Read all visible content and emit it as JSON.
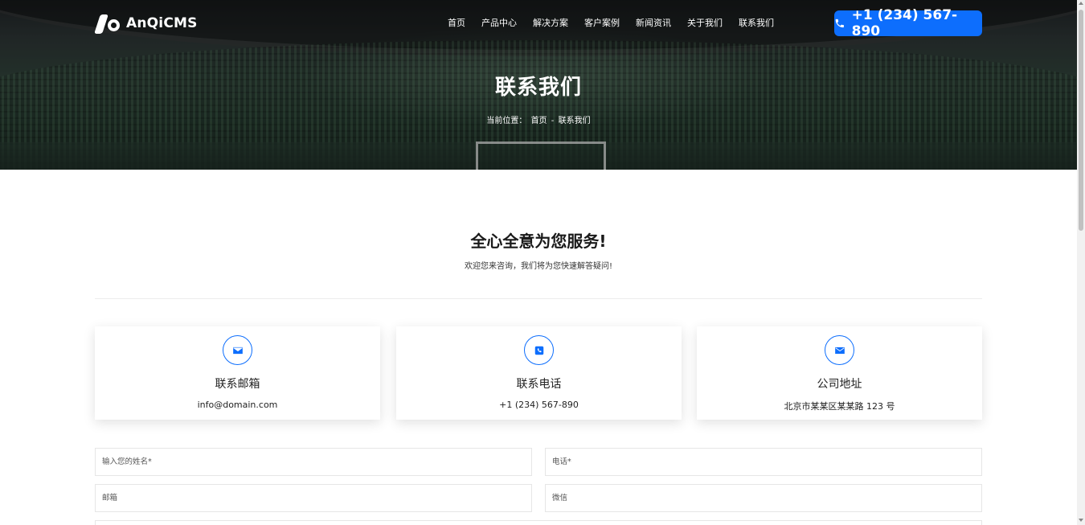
{
  "header": {
    "logo_text": "AnQiCMS",
    "nav": [
      "首页",
      "产品中心",
      "解决方案",
      "客户案例",
      "新闻资讯",
      "关于我们",
      "联系我们"
    ],
    "phone_button": "+1 (234) 567-890"
  },
  "hero": {
    "title": "联系我们",
    "breadcrumb_label": "当前位置：",
    "breadcrumb_home": "首页",
    "breadcrumb_sep": "-",
    "breadcrumb_current": "联系我们"
  },
  "section": {
    "title": "全心全意为您服务!",
    "subtitle": "欢迎您来咨询，我们将为您快速解答疑问!"
  },
  "cards": [
    {
      "icon": "envelope-icon",
      "title": "联系邮箱",
      "value": "info@domain.com"
    },
    {
      "icon": "phone-icon",
      "title": "联系电话",
      "value": "+1 (234) 567-890"
    },
    {
      "icon": "envelope-icon",
      "title": "公司地址",
      "value": "北京市某某区某某路 123 号"
    }
  ],
  "form": {
    "name_placeholder": "输入您的姓名*",
    "phone_placeholder": "电话*",
    "email_placeholder": "邮箱",
    "wechat_placeholder": "微信"
  },
  "colors": {
    "accent": "#0d6efd"
  }
}
